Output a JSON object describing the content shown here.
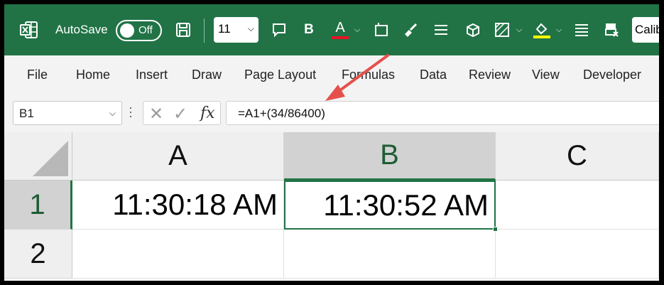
{
  "titlebar": {
    "autosave_label": "AutoSave",
    "autosave_state": "Off",
    "font_size": "11",
    "font_name": "Calib",
    "accent_color": "#217346"
  },
  "tabs": [
    "File",
    "Home",
    "Insert",
    "Draw",
    "Page Layout",
    "Formulas",
    "Data",
    "Review",
    "View",
    "Developer"
  ],
  "formula_bar": {
    "name_box": "B1",
    "fx_label": "fx",
    "formula": "=A1+(34/86400)"
  },
  "grid": {
    "columns": [
      "A",
      "B",
      "C"
    ],
    "rows": [
      "1",
      "2"
    ],
    "cells": {
      "A1": "11:30:18 AM",
      "B1": "11:30:52 AM"
    }
  },
  "icons": [
    "excel-icon",
    "save-icon",
    "comment-icon",
    "bold-icon",
    "font-color-icon",
    "borders-icon",
    "format-painter-icon",
    "align-icon",
    "cube-icon",
    "fill-pattern-icon",
    "fill-color-icon",
    "align-justify-icon",
    "clear-format-icon"
  ]
}
